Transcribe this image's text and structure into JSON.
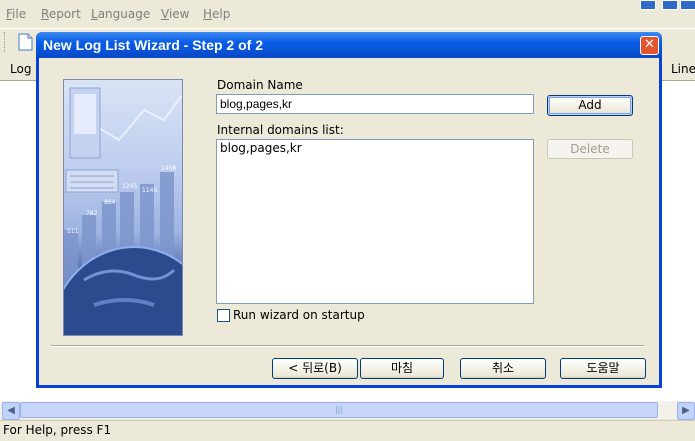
{
  "menu": {
    "items": [
      {
        "label": "File",
        "hotkey": "F",
        "rest": "ile"
      },
      {
        "label": "Report",
        "hotkey": "R",
        "rest": "eport"
      },
      {
        "label": "Language",
        "hotkey": "L",
        "rest": "anguage"
      },
      {
        "label": "View",
        "hotkey": "V",
        "rest": "iew"
      },
      {
        "label": "Help",
        "hotkey": "H",
        "rest": "elp"
      }
    ]
  },
  "list": {
    "col_left": "Log",
    "col_right": "Line"
  },
  "status": {
    "text": "For Help, press F1"
  },
  "wizard": {
    "title": "New Log List Wizard - Step 2 of 2",
    "close_glyph": "✕",
    "domain_label": "Domain Name",
    "domain_value": "blog,pages,kr",
    "add_label": "Add",
    "internal_label": "Internal domains list:",
    "internal_items": [
      "blog,pages,kr"
    ],
    "delete_label": "Delete",
    "startup_label": "Run wizard on startup",
    "startup_checked": false,
    "back_label": "< 뒤로(B)",
    "finish_label": "마침",
    "cancel_label": "취소",
    "help_label": "도움말"
  },
  "art_numbers": [
    "1456",
    "1145",
    "1245",
    "864",
    "782",
    "511"
  ],
  "colors": {
    "title_blue": "#0a5de6",
    "close_red": "#e2552e",
    "face": "#ece9d8"
  }
}
